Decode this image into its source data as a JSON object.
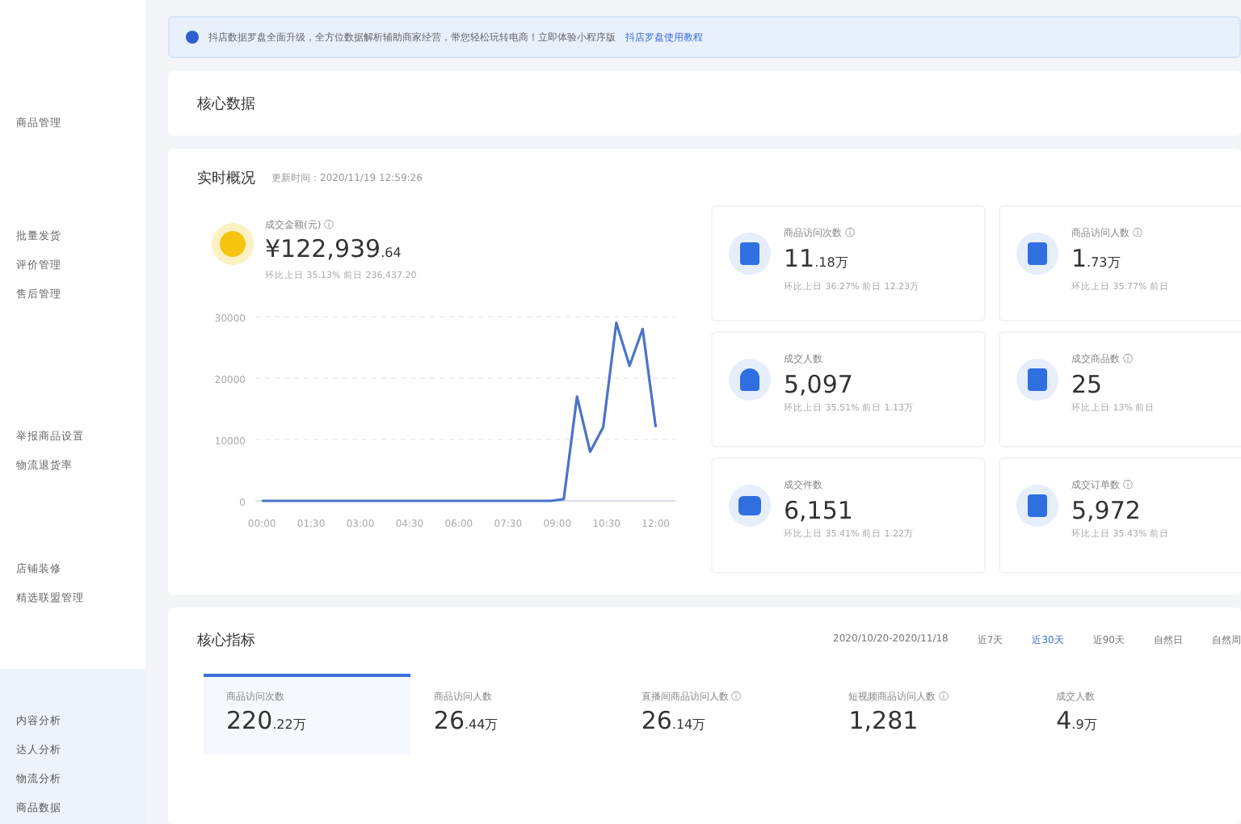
{
  "sidebar": {
    "groups": [
      {
        "items": [
          {
            "label": "商品管理",
            "selected": false
          }
        ]
      },
      {
        "items": [
          {
            "label": "批量发货",
            "selected": false
          },
          {
            "label": "评价管理",
            "selected": false
          },
          {
            "label": "售后管理",
            "selected": false
          }
        ]
      },
      {
        "items": [
          {
            "label": "举报商品设置",
            "selected": false
          },
          {
            "label": "物流退货率",
            "selected": false
          }
        ]
      },
      {
        "items": [
          {
            "label": "店铺装修",
            "selected": false
          },
          {
            "label": "精选联盟管理",
            "selected": false
          }
        ]
      },
      {
        "items": [
          {
            "label": "内容分析",
            "selected": true
          },
          {
            "label": "达人分析",
            "selected": true
          },
          {
            "label": "物流分析",
            "selected": true
          },
          {
            "label": "商品数据",
            "selected": true
          }
        ]
      }
    ]
  },
  "notice": {
    "text": "抖店数据罗盘全面升级，全方位数据解析辅助商家经营，带您轻松玩转电商！立即体验小程序版",
    "link": "抖店罗盘使用教程"
  },
  "core_data": {
    "title": "核心数据"
  },
  "realtime": {
    "title": "实时概况",
    "updated": "更新时间：2020/11/19 12:59:26",
    "revenue": {
      "label": "成交金额(元) ⓘ",
      "value": "¥122,939",
      "value_small": ".64",
      "compare": "环比上日 35.13%  前日 236,437.20"
    },
    "chart_data": {
      "type": "line",
      "x": [
        0,
        1,
        2,
        3,
        4,
        5,
        6,
        7,
        8,
        8.8,
        9.2,
        9.6,
        10.0,
        10.4,
        10.8,
        11.2,
        11.6,
        12.0
      ],
      "series": [
        {
          "color": "#4a74c9",
          "values": [
            0,
            0,
            0,
            0,
            0,
            0,
            0,
            0,
            0,
            0,
            300,
            17000,
            8000,
            12000,
            29000,
            22000,
            28000,
            12000
          ]
        }
      ],
      "xlim": [
        -0.2,
        12.6
      ],
      "ylim": [
        0,
        30000
      ],
      "yticks": [
        0,
        10000,
        20000,
        30000
      ],
      "xticks": [
        {
          "value": 0,
          "label": "00:00"
        },
        {
          "value": 1.5,
          "label": "01:30"
        },
        {
          "value": 3,
          "label": "03:00"
        },
        {
          "value": 4.5,
          "label": "04:30"
        },
        {
          "value": 6,
          "label": "06:00"
        },
        {
          "value": 7.5,
          "label": "07:30"
        },
        {
          "value": 9,
          "label": "09:00"
        },
        {
          "value": 10.5,
          "label": "10:30"
        },
        {
          "value": 12,
          "label": "12:00"
        }
      ]
    },
    "stats": [
      {
        "kind": "doc",
        "label": "商品访问次数 ⓘ",
        "value": "11",
        "value_small": ".18万",
        "compare": "环比上日 36.27%  前日 12.23万"
      },
      {
        "kind": "doc",
        "label": "商品访问人数 ⓘ",
        "value": "1",
        "value_small": ".73万",
        "compare": "环比上日 35.77%  前日"
      },
      {
        "kind": "person",
        "label": "成交人数",
        "value": "5,097",
        "compare": "环比上日 35.51%  前日 1.13万"
      },
      {
        "kind": "doc",
        "label": "成交商品数 ⓘ",
        "value": "25",
        "compare": "环比上日 13%  前日"
      },
      {
        "kind": "bag",
        "label": "成交件数",
        "value": "6,151",
        "compare": "环比上日 35.41%  前日 1.22万"
      },
      {
        "kind": "doc",
        "label": "成交订单数 ⓘ",
        "value": "5,972",
        "compare": "环比上日 35.43%  前日"
      }
    ]
  },
  "core_metrics": {
    "title": "核心指标",
    "range": "2020/10/20-2020/11/18",
    "periods": [
      {
        "label": "近7天",
        "selected": false
      },
      {
        "label": "近30天",
        "selected": true
      },
      {
        "label": "近90天",
        "selected": false
      },
      {
        "label": "自然日",
        "selected": false
      },
      {
        "label": "自然周",
        "selected": false
      }
    ],
    "metrics": [
      {
        "label": "商品访问次数",
        "value": "220",
        "value_small": ".22万",
        "selected": true
      },
      {
        "label": "商品访问人数",
        "value": "26",
        "value_small": ".44万",
        "selected": false
      },
      {
        "label": "直播间商品访问人数 ⓘ",
        "value": "26",
        "value_small": ".14万",
        "selected": false
      },
      {
        "label": "短视频商品访问人数 ⓘ",
        "value": "1,281",
        "selected": false
      },
      {
        "label": "成交人数",
        "value": "4",
        "value_small": ".9万",
        "selected": false
      }
    ]
  }
}
